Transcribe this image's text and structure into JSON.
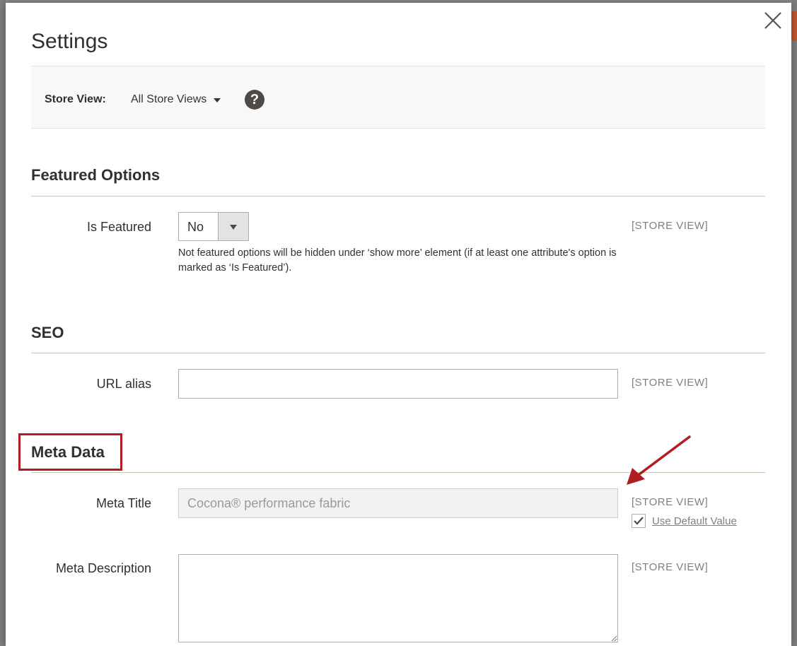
{
  "modal": {
    "title": "Settings"
  },
  "store_view": {
    "label": "Store View:",
    "value": "All Store Views"
  },
  "sections": {
    "featured": {
      "title": "Featured Options",
      "is_featured_label": "Is Featured",
      "is_featured_value": "No",
      "note": "Not featured options will be hidden under ‘show more’ element (if at least one attribute's option is marked as ‘Is Featured’).",
      "scope": "[STORE VIEW]"
    },
    "seo": {
      "title": "SEO",
      "url_alias_label": "URL alias",
      "url_alias_value": "",
      "scope": "[STORE VIEW]"
    },
    "meta": {
      "title": "Meta Data",
      "meta_title_label": "Meta Title",
      "meta_title_value": "Cocona® performance fabric",
      "meta_title_scope": "[STORE VIEW]",
      "use_default_label": "Use Default Value",
      "use_default_checked": true,
      "meta_description_label": "Meta Description",
      "meta_description_value": "",
      "meta_description_scope": "[STORE VIEW]"
    }
  },
  "icons": {
    "close": "close-icon",
    "help": "question-circle-icon",
    "checkmark": "checkmark-icon",
    "annotation_arrow": "arrow-icon"
  },
  "colors": {
    "highlight": "#b01e23",
    "help_bg": "#514943",
    "scope_text": "#808080"
  }
}
